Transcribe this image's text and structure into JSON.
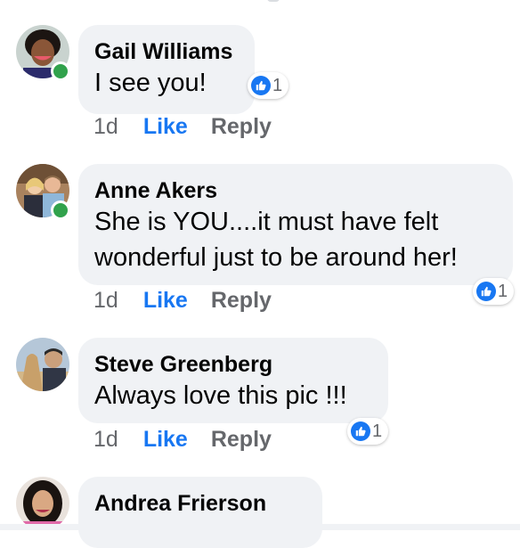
{
  "comments": [
    {
      "author": "Gail Williams",
      "text": "I see you!",
      "time": "1d",
      "like_label": "Like",
      "reply_label": "Reply",
      "reaction_count": "1",
      "online": true
    },
    {
      "author": "Anne Akers",
      "text": "She is YOU....it must have felt wonderful just to be around her!",
      "time": "1d",
      "like_label": "Like",
      "reply_label": "Reply",
      "reaction_count": "1",
      "online": true
    },
    {
      "author": "Steve Greenberg",
      "text": "Always love this pic !!!",
      "time": "1d",
      "like_label": "Like",
      "reply_label": "Reply",
      "reaction_count": "1",
      "online": false
    },
    {
      "author": "Andrea Frierson",
      "text": "",
      "online": false
    }
  ],
  "colors": {
    "bubble": "#f0f2f5",
    "like_blue": "#1877f2",
    "meta_gray": "#65676b",
    "online_green": "#31a24c"
  },
  "icons": {
    "reaction": "thumbs-up-icon"
  }
}
